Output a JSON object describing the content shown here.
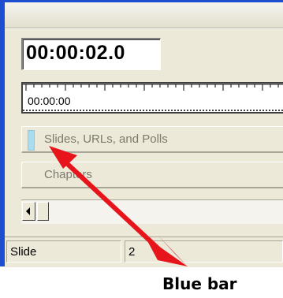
{
  "timecode": {
    "value": "00:00:02.0"
  },
  "timeline": {
    "ruler_start": "00:00:00",
    "tracks": [
      {
        "label": "Slides, URLs, and Polls"
      },
      {
        "label": "Chapters"
      }
    ]
  },
  "status_bar": {
    "field_name": "Slide",
    "field_value": "2"
  },
  "annotation": {
    "label": "Blue bar",
    "arrow_color": "#e8141c"
  },
  "colors": {
    "window_frame": "#1c4ecf",
    "blue_bar": "#aadcf0",
    "panel": "#ece9d8"
  }
}
